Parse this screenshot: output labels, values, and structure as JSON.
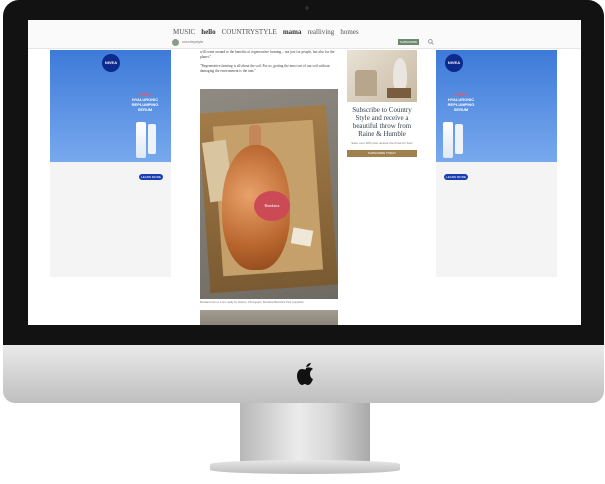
{
  "site": {
    "brands": [
      "MUSIC",
      "hello",
      "COUNTRYSTYLE",
      "mama",
      "realliving",
      "homes"
    ],
    "site_name": "countrystyle",
    "subscribe_label": "SUBSCRIBE"
  },
  "article": {
    "para1": "will come around to the benefits of regenerative farming – not just for people, but also for the planet.\"",
    "para2": "\"Regenerative farming is all about the soil. For us, getting the most out of our soil without damaging the environment is the aim.\"",
    "ham_label": "Bundarra",
    "caption": "Bundarra ham in a box ready for delivery. Photograph: Bundarra Berkshire Pork (supplied)"
  },
  "promo": {
    "title": "Subscribe to Country Style and receive a beautiful throw from Raine & Humble",
    "subtitle": "Save over 30% plus receive the throw for free!",
    "button": "SUBSCRIBE TODAY"
  },
  "ads": {
    "left": {
      "logo": "NIVEA",
      "step": "STEP 1",
      "line1": "HYALURONIC",
      "line2": "REPLUMPING",
      "line3": "SERUM",
      "button": "LEARN MORE"
    },
    "right": {
      "logo": "NIVEA",
      "step": "STEP 1",
      "line1": "HYALURONIC",
      "line2": "REPLUMPING",
      "line3": "SERUM",
      "button": "LEARN MORE"
    }
  },
  "colors": {
    "bezel": "#121212",
    "nivea_blue": "#3d7ad8",
    "promo_button": "#a0804f",
    "subscribe_button": "#6e8a6e"
  }
}
